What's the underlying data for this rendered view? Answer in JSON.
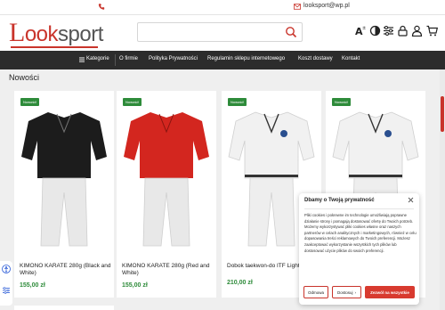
{
  "topbar": {
    "email": "looksport@wp.pl"
  },
  "header": {
    "logo_part1": "L",
    "logo_part2": "ook",
    "logo_part3": "sport",
    "search_placeholder": ""
  },
  "nav": {
    "categories": "Kategorie",
    "items": [
      "O firmie",
      "Polityka Prywatności",
      "Regulamin sklepu internetowego",
      "Koszt dostawy",
      "Kontakt"
    ]
  },
  "section_title": "Nowości",
  "products": [
    {
      "badge": "Nowość!",
      "name": "KIMONO KARATE 280g (Black and White)",
      "price": "155,00 zł",
      "gi_color": "#1c1c1c",
      "pants_color": "#e8e8e8"
    },
    {
      "badge": "Nowość!",
      "name": "KIMONO KARATE 280g (Red and White)",
      "price": "155,00 zł",
      "gi_color": "#d3261f",
      "pants_color": "#e8e8e8"
    },
    {
      "badge": "Nowość!",
      "name": "Dobok taekwon-do ITF Light",
      "price": "210,00 zł",
      "gi_color": "#f1f1f1",
      "pants_color": "#eeeeee"
    },
    {
      "badge": "Nowość!",
      "name": "",
      "price": "",
      "gi_color": "#f1f1f1",
      "pants_color": "#eeeeee"
    }
  ],
  "cookie": {
    "title": "Dbamy o Twoją prywatność",
    "text": "Pliki cookies i pokrewne im technologie umożliwiają poprawne działanie strony i pomagają dostosować ofertę do Twoich potrzeb. Możemy wykorzystywać pliki cookies własne oraz naszych partnerów w celach analitycznych i marketingowych, również w celu dopasowania treści reklamowych do Twoich preferencji. Możesz zaakceptować wykorzystanie wszystkich tych plików lub dostosować użycie plików do swoich preferencji.",
    "reject": "Odmowa",
    "customize": "Dostosuj",
    "accept": "Zezwól na wszystkie"
  },
  "colors": {
    "brand": "#c9342b",
    "price": "#2e8b3a",
    "nav_bg": "#2c2c2c"
  }
}
